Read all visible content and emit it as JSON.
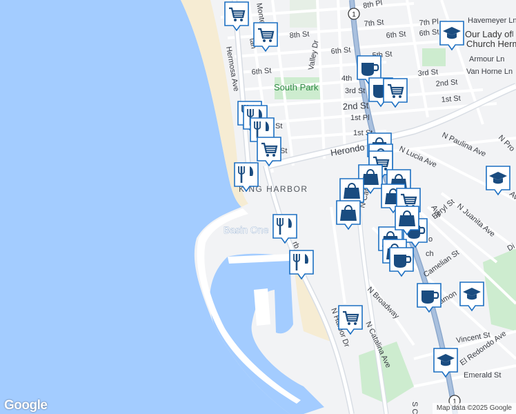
{
  "map": {
    "labels": {
      "king_harbor": "KING HARBOR",
      "basin_one": "Basin One",
      "south_park": "South Park"
    },
    "streets": [
      {
        "id": "8th-pl",
        "text": "8th Pl"
      },
      {
        "id": "8th-st",
        "text": "8th St"
      },
      {
        "id": "7th-st",
        "text": "7th St"
      },
      {
        "id": "7th-pl",
        "text": "7th Pl"
      },
      {
        "id": "6th-st-a",
        "text": "6th St"
      },
      {
        "id": "6th-st-b",
        "text": "6th St"
      },
      {
        "id": "6th-st-c",
        "text": "6th St"
      },
      {
        "id": "6th-st-d",
        "text": "6th St"
      },
      {
        "id": "5th-st",
        "text": "5th St"
      },
      {
        "id": "4th",
        "text": "4th"
      },
      {
        "id": "3rd-st-a",
        "text": "3rd St"
      },
      {
        "id": "3rd-st-b",
        "text": "3rd St"
      },
      {
        "id": "2nd-st-a",
        "text": "2nd St"
      },
      {
        "id": "2nd-st-b",
        "text": "2nd St"
      },
      {
        "id": "1st-pl",
        "text": "1st Pl"
      },
      {
        "id": "1st-st-a",
        "text": "1st St"
      },
      {
        "id": "1st-st-b",
        "text": "1st St"
      },
      {
        "id": "havemeyer",
        "text": "Havemeyer Ln"
      },
      {
        "id": "armour",
        "text": "Armour Ln"
      },
      {
        "id": "van-horne",
        "text": "Van Horne Ln"
      },
      {
        "id": "herondo",
        "text": "Herondo"
      },
      {
        "id": "n-paulina",
        "text": "N Paulina Ave"
      },
      {
        "id": "n-lucia",
        "text": "N Lucia Ave"
      },
      {
        "id": "n-catalina-a",
        "text": "N Catal"
      },
      {
        "id": "n-catalina-b",
        "text": "N Catalina Ave"
      },
      {
        "id": "n-juanita",
        "text": "N Juanita Ave"
      },
      {
        "id": "beryl",
        "text": "Beryl St"
      },
      {
        "id": "camelian",
        "text": "Camelian St"
      },
      {
        "id": "diamond",
        "text": "Diamon"
      },
      {
        "id": "n-broadway",
        "text": "N Broadway"
      },
      {
        "id": "vincent",
        "text": "Vincent St"
      },
      {
        "id": "el-redondo",
        "text": "El Redondo Ave"
      },
      {
        "id": "emerald",
        "text": "Emerald St"
      },
      {
        "id": "hermosa-ave",
        "text": "Hermosa Ave"
      },
      {
        "id": "monte",
        "text": "Monte"
      },
      {
        "id": "valley-dr",
        "text": "Valley Dr"
      },
      {
        "id": "harbor",
        "text": "rb"
      },
      {
        "id": "n-harbor-dr",
        "text": "N Harbor Dr"
      },
      {
        "id": "fragment-ave",
        "text": "Ave"
      },
      {
        "id": "fragment-ave2",
        "text": "Ave"
      },
      {
        "id": "fragment-n-pro",
        "text": "N Pro"
      },
      {
        "id": "fragment-di",
        "text": "Di"
      },
      {
        "id": "fragment-s-c",
        "text": "S C"
      },
      {
        "id": "fragment-tan",
        "text": "tan"
      },
      {
        "id": "fragment-st",
        "text": "St"
      },
      {
        "id": "fragment-st2",
        "text": "St"
      },
      {
        "id": "fragment-o",
        "text": "o"
      },
      {
        "id": "fragment-ch",
        "text": "ch"
      },
      {
        "id": "fragment-l",
        "text": "l"
      }
    ],
    "pois": [
      {
        "id": "our-lady",
        "line1": "Our Lady of",
        "line2": "Church Herm"
      }
    ],
    "route_shields": [
      "1",
      "1"
    ],
    "colors": {
      "water": "#a3ccff",
      "land": "#f2f3f5",
      "beach": "#f6ecd3",
      "park": "#cdeccf",
      "road_major": "#8ca8cc",
      "pin_fill": "#ffffff",
      "pin_border": "#1b6fc2",
      "icon": "#1a4c80"
    },
    "markers": [
      {
        "type": "shopping-cart"
      },
      {
        "type": "shopping-cart"
      },
      {
        "type": "school"
      },
      {
        "type": "coffee"
      },
      {
        "type": "coffee"
      },
      {
        "type": "shopping-cart"
      },
      {
        "type": "restaurant"
      },
      {
        "type": "restaurant"
      },
      {
        "type": "restaurant"
      },
      {
        "type": "shopping-cart"
      },
      {
        "type": "shopping-bag"
      },
      {
        "type": "shopping-bag"
      },
      {
        "type": "shopping-cart"
      },
      {
        "type": "restaurant"
      },
      {
        "type": "shopping-bag"
      },
      {
        "type": "shopping-bag"
      },
      {
        "type": "shopping-bag"
      },
      {
        "type": "shopping-bag"
      },
      {
        "type": "school"
      },
      {
        "type": "shopping-bag"
      },
      {
        "type": "shopping-cart"
      },
      {
        "type": "shopping-bag"
      },
      {
        "type": "coffee"
      },
      {
        "type": "restaurant"
      },
      {
        "type": "restaurant"
      },
      {
        "type": "shopping-bag"
      },
      {
        "type": "shopping-bag"
      },
      {
        "type": "coffee"
      },
      {
        "type": "coffee"
      },
      {
        "type": "school"
      },
      {
        "type": "shopping-cart"
      },
      {
        "type": "school"
      }
    ]
  },
  "footer": {
    "logo": "Google",
    "attribution": "Map data ©2025 Google"
  }
}
